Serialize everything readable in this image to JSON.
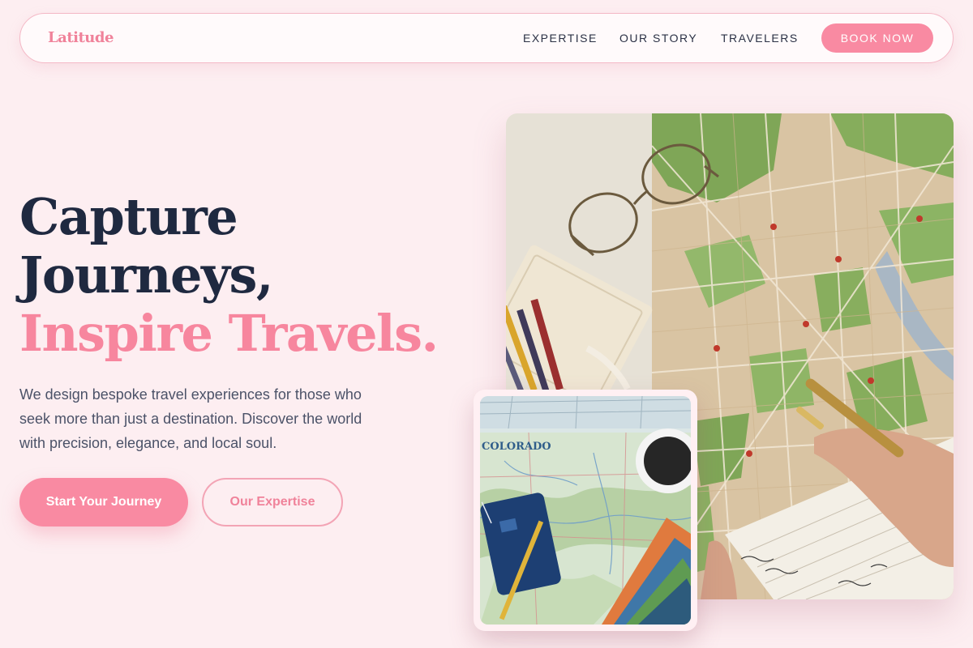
{
  "header": {
    "logo": "Latitude",
    "nav": [
      "EXPERTISE",
      "OUR STORY",
      "TRAVELERS"
    ],
    "cta": "BOOK NOW"
  },
  "hero": {
    "headline_line1": "Capture",
    "headline_line2": "Journeys,",
    "headline_accent": "Inspire Travels.",
    "description": "We design bespoke travel experiences for those who seek more than just a destination. Discover the world with precision, elegance, and local soul.",
    "primary_button": "Start Your Journey",
    "secondary_button": "Our Expertise"
  },
  "images": {
    "small_map_label": "COLORADO"
  },
  "colors": {
    "accent": "#f98aa2",
    "background": "#fdeef1",
    "heading": "#1f2940"
  }
}
